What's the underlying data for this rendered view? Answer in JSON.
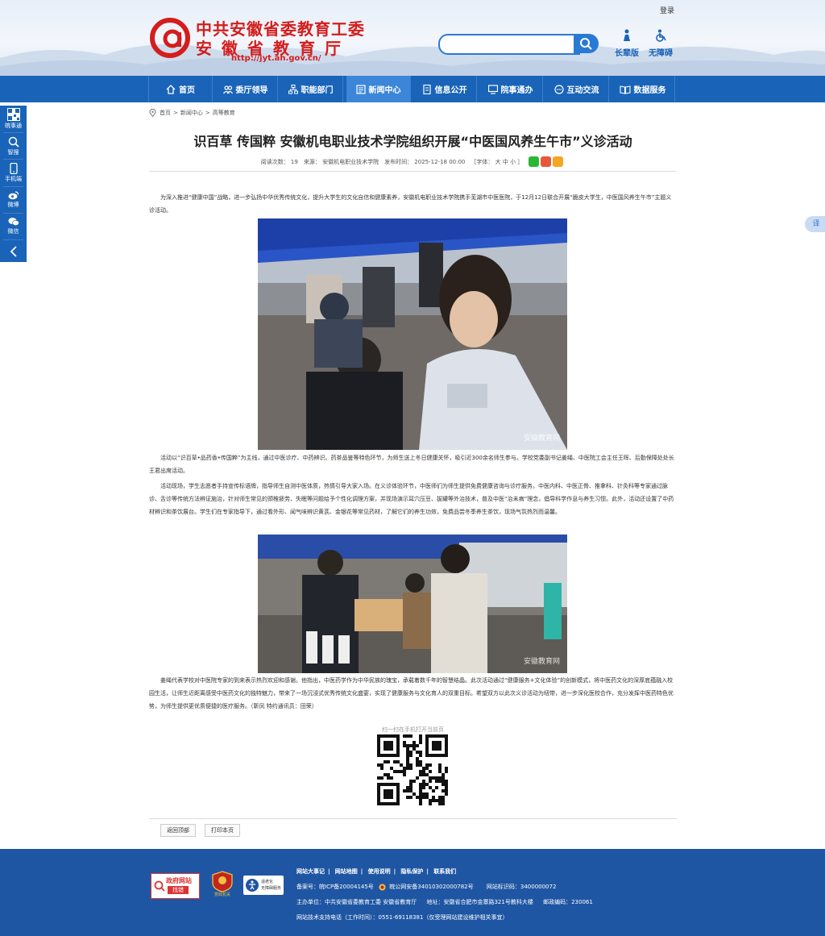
{
  "header": {
    "login": "登录",
    "logo_line1": "中共安徽省委教育工委",
    "logo_line2": "安徽省教育厅",
    "logo_url": "http://jyt.ah.gov.cn/",
    "search_placeholder": "",
    "tools": [
      "长辈版",
      "无障碍"
    ]
  },
  "nav": [
    "首页",
    "委厅领导",
    "职能部门",
    "新闻中心",
    "信息公开",
    "院事通办",
    "互动交流",
    "数据服务"
  ],
  "nav_active": "新闻中心",
  "left_bar": [
    "皖事通",
    "智搜",
    "手机端",
    "微博",
    "微信"
  ],
  "right_tab": "译",
  "breadcrumb": [
    "首页",
    ">",
    "新闻中心",
    ">",
    "高等教育"
  ],
  "article": {
    "title": "识百草 传国粹 安徽机电职业技术学院组织开展“中医国风养生午市”义诊活动",
    "meta": {
      "views": "阅读次数：  19",
      "source": "来源：  安徽机电职业技术学院",
      "time": "发布时间：  2025-12-18 00:00",
      "font": "［字体：  大  中  小 ］"
    },
    "p1": "为深入推进“健康中国”战略，进一步弘扬中华优秀传统文化，提升大学生的文化自信和健康素养，安徽机电职业技术学院携手芜湖市中医医院，于12月12日联合开展“脆皮大学生，中医国风养生午市”主题义诊活动。",
    "p2": "活动以“识百草•品药香•传国粹”为主线，通过中医诊疗、中药辨识、药茶品鉴等特色环节，为师生送上冬日健康关怀，吸引近300余名师生参与。学校党委副书记姜绳、中医院工会主任王晖、后勤保障处处长王君出席活动。",
    "p3": "活动现场，学生志愿者手持宣传标语牌，指导师生自测中医体质，热情引导大家入场。在义诊体验环节，中医师们为师生提供免费健康咨询与诊疗服务。中医内科、中医正骨、推拿科、针灸科等专家通过脉诊、舌诊等传统方法辨证施治，针对师生常见的颈椎疲劳、失眠等问题给予个性化调理方案，并现场演示耳穴压豆、拔罐等外治技术，普及中医“治未病”理念，倡导科学作息与养生习惯。此外，活动还设置了中药材辨识和茶饮展台。学生们在专家指导下，通过看外形、闻气味辨识黄芪、金银花等常见药材，了解它们的养生功效，免费品尝冬季养生茶饮，现场气氛热烈而温馨。",
    "p4": "姜绳代表学校对中医院专家的到来表示热烈欢迎和感谢。他指出，中医药学作为中华民族的瑰宝，承载着数千年的智慧结晶。此次活动通过“健康服务+文化体验”的创新模式，将中医药文化的深厚底蕴融入校园生活，让师生近距离感受中医药文化的独特魅力，带来了一场沉浸式优秀传统文化盛宴，实现了健康服务与文化育人的双重目标。希望双方以此次义诊活动为纽带，进一步深化医校合作，充分发挥中医药特色优势，为师生提供更优质便捷的医疗服务。（靳凤 特约通讯员：田荣）",
    "photo_watermark": "安徽教育网",
    "qr_caption": "扫一扫在手机打开当前页",
    "buttons": [
      "返回顶部",
      "打印本页"
    ]
  },
  "footer": {
    "links": [
      "网站大事记",
      "网站地图",
      "使用说明",
      "隐私保护",
      "联系我们"
    ],
    "badges": [
      "政府网站",
      "找错",
      "党政机关",
      "适老化",
      "无障碍服务"
    ],
    "icp": "备案号：皖ICP备20004145号",
    "police": "皖公网安备34010302000782号",
    "site_code": "网站标识码：3400000072",
    "host": "主办单位：中共安徽省委教育工委 安徽省教育厅",
    "address": "地址：安徽省合肥市金寨路321号教科大楼",
    "postcode": "邮政编码：230061",
    "support": "网站技术支持电话（工作时间）：0551-69118381（仅受理网站建设维护相关事宜）"
  }
}
